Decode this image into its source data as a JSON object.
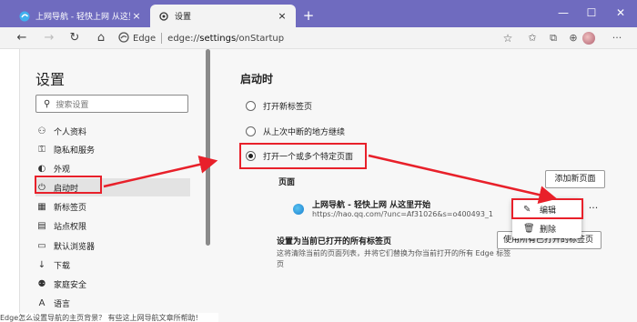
{
  "tabs": [
    {
      "label": "上网导航 - 轻快上网 从这里开始",
      "close": "×"
    },
    {
      "label": "设置",
      "close": "×"
    }
  ],
  "new_tab": "+",
  "window": {
    "minimize": "—",
    "maximize": "☐",
    "close": "✕"
  },
  "address": {
    "brand": "Edge",
    "url_prefix": "edge://",
    "url_main": "settings",
    "url_rest": "/onStartup"
  },
  "sidebar": {
    "title": "设置",
    "search_placeholder": "搜索设置",
    "items": [
      {
        "label": "个人资料",
        "icon": "person-icon"
      },
      {
        "label": "隐私和服务",
        "icon": "lock-icon"
      },
      {
        "label": "外观",
        "icon": "palette-icon"
      },
      {
        "label": "启动时",
        "icon": "power-icon"
      },
      {
        "label": "新标签页",
        "icon": "grid-icon"
      },
      {
        "label": "站点权限",
        "icon": "site-icon"
      },
      {
        "label": "默认浏览器",
        "icon": "browser-icon"
      },
      {
        "label": "下载",
        "icon": "download-icon"
      },
      {
        "label": "家庭安全",
        "icon": "family-icon"
      },
      {
        "label": "语言",
        "icon": "language-icon"
      }
    ]
  },
  "main": {
    "title": "启动时",
    "options": [
      "打开新标签页",
      "从上次中断的地方继续",
      "打开一个或多个特定页面"
    ],
    "selected": 2,
    "pages_label": "页面",
    "add_button": "添加新页面",
    "page": {
      "title": "上网导航 - 轻快上网 从这里开始",
      "url": "https://hao.qq.com/?unc=Af31026&s=o400493_1"
    },
    "more": "···",
    "use_all_title": "设置为当前已打开的所有标签页",
    "use_all_desc": "这将清除当前的页面列表，并将它们替换为你当前打开的所有 Edge 标签页",
    "use_button": "使用所有已打开的标签页"
  },
  "context_menu": [
    {
      "label": "编辑",
      "icon": "pencil-icon"
    },
    {
      "label": "删除",
      "icon": "trash-icon"
    }
  ],
  "bottom_text": "Edge怎么设置导航的主页背景？ 有些这上网导航文章所帮助!",
  "colors": {
    "highlight": "#e8202a",
    "titlebar": "#6f6bbf"
  }
}
